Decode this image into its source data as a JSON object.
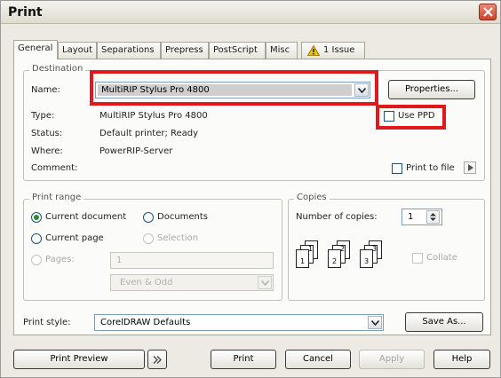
{
  "window": {
    "title": "Print"
  },
  "tabs": [
    {
      "label": "General"
    },
    {
      "label": "Layout"
    },
    {
      "label": "Separations"
    },
    {
      "label": "Prepress"
    },
    {
      "label": "PostScript"
    },
    {
      "label": "Misc"
    },
    {
      "label": "1 Issue"
    }
  ],
  "destination": {
    "legend": "Destination",
    "name_label": "Name:",
    "name_value": "MultiRIP Stylus Pro 4800",
    "properties_button": "Properties...",
    "type_label": "Type:",
    "type_value": "MultiRIP Stylus Pro 4800",
    "use_ppd_label": "Use PPD",
    "status_label": "Status:",
    "status_value": "Default printer; Ready",
    "where_label": "Where:",
    "where_value": "PowerRIP-Server",
    "comment_label": "Comment:",
    "print_to_file_label": "Print to file"
  },
  "print_range": {
    "legend": "Print range",
    "current_document": "Current document",
    "documents": "Documents",
    "current_page": "Current page",
    "selection": "Selection",
    "pages_label": "Pages:",
    "pages_value": "1",
    "page_set": "Even & Odd"
  },
  "copies": {
    "legend": "Copies",
    "number_label": "Number of copies:",
    "number_value": "1",
    "collate_label": "Collate"
  },
  "print_style": {
    "label": "Print style:",
    "value": "CorelDRAW Defaults",
    "save_as_button": "Save As..."
  },
  "footer": {
    "print_preview": "Print Preview",
    "print": "Print",
    "cancel": "Cancel",
    "apply": "Apply",
    "help": "Help"
  },
  "colors": {
    "highlight": "#e0191c",
    "warning": "#f2c200"
  }
}
